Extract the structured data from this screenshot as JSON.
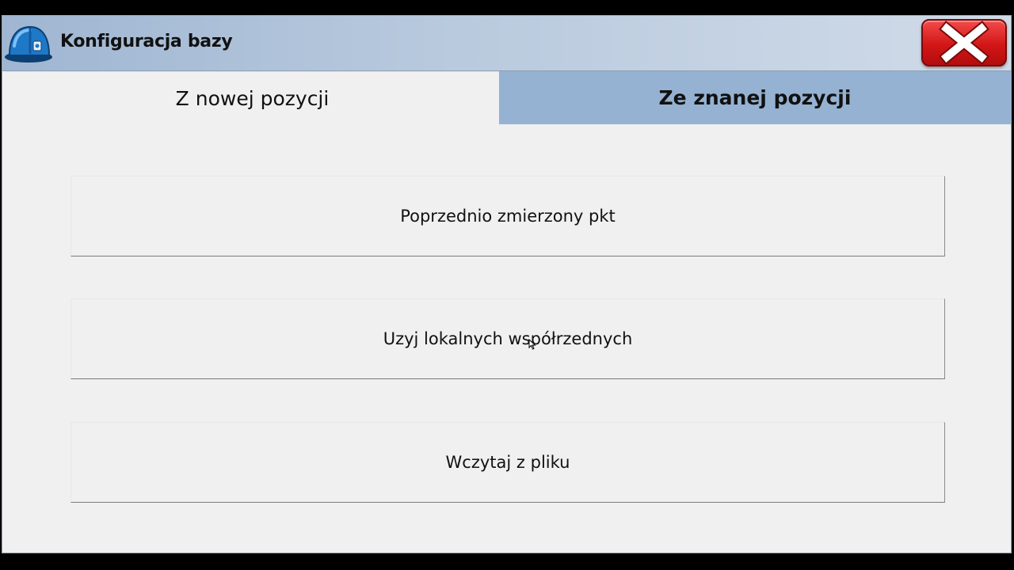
{
  "window": {
    "title": "Konfiguracja bazy",
    "app_icon": "hard-hat-icon",
    "close_icon": "close-icon"
  },
  "tabs": [
    {
      "label": "Z nowej pozycji",
      "active": false
    },
    {
      "label": "Ze znanej pozycji",
      "active": true
    }
  ],
  "options": [
    {
      "label": "Poprzednio zmierzony pkt"
    },
    {
      "label": "Uzyj lokalnych współrzednych"
    },
    {
      "label": "Wczytaj z pliku"
    }
  ],
  "colors": {
    "titlebar_gradient_start": "#9fb6d2",
    "titlebar_gradient_end": "#d0dbe8",
    "active_tab": "#95b2d2",
    "close_button": "#d31616",
    "panel_background": "#f0f0f0"
  }
}
